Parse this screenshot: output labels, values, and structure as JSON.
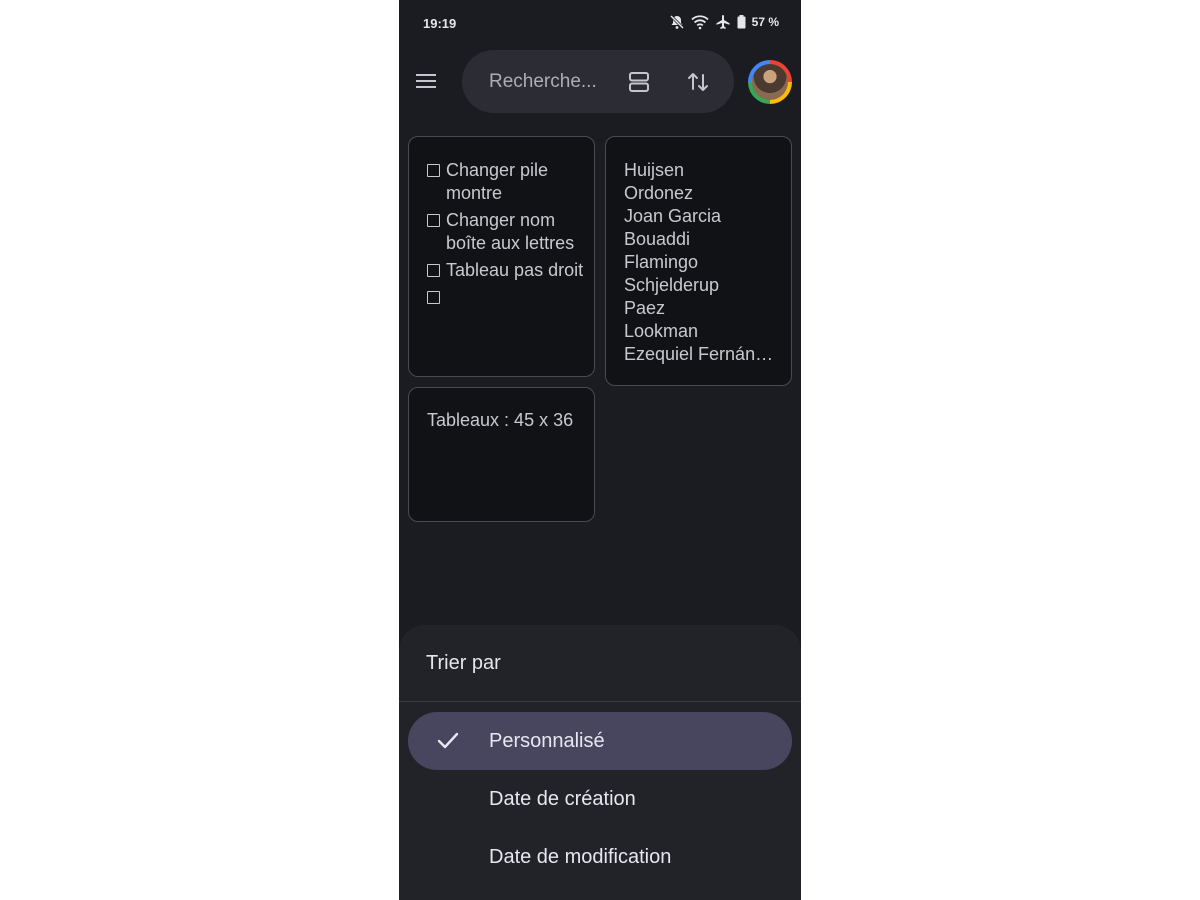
{
  "status_bar": {
    "time": "19:19",
    "battery_percent": "57 %",
    "icons": [
      "notifications-off-icon",
      "wifi-icon",
      "airplane-icon",
      "battery-icon"
    ]
  },
  "top_bar": {
    "search_placeholder": "Recherche...",
    "icons": [
      "menu-icon",
      "layout-icon",
      "sort-icon",
      "avatar"
    ]
  },
  "notes": {
    "checklist": [
      {
        "text": "Changer pile montre",
        "checked": false
      },
      {
        "text": "Changer nom boîte aux lettres",
        "checked": false
      },
      {
        "text": "Tableau pas droit",
        "checked": false
      },
      {
        "text": "",
        "checked": false
      }
    ],
    "names": [
      "Huijsen",
      "Ordonez",
      "Joan Garcia",
      "Bouaddi",
      "Flamingo",
      "Schjelderup",
      "Paez",
      "Lookman",
      "Ezequiel Fernán…"
    ],
    "text_note": "Tableaux : 45 x 36"
  },
  "sort_sheet": {
    "title": "Trier par",
    "options": [
      {
        "label": "Personnalisé",
        "selected": true
      },
      {
        "label": "Date de création",
        "selected": false
      },
      {
        "label": "Date de modification",
        "selected": false
      }
    ]
  },
  "colors": {
    "background": "#1b1c22",
    "note_background": "#111216",
    "sheet_background": "#222229",
    "selected_option": "#48455f",
    "search_pill": "#2c2d34"
  }
}
